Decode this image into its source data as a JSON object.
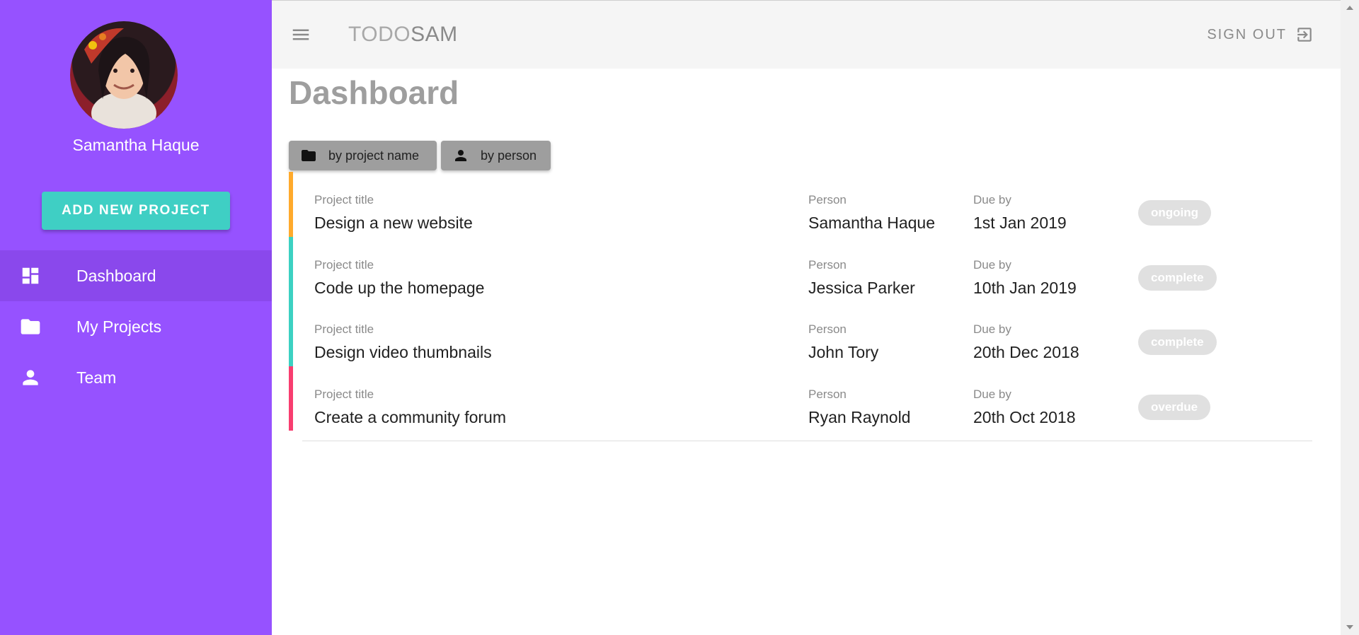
{
  "sidebar": {
    "user_name": "Samantha Haque",
    "add_button_label": "ADD NEW PROJECT",
    "items": [
      {
        "label": "Dashboard",
        "icon": "dashboard-icon",
        "active": true
      },
      {
        "label": "My Projects",
        "icon": "folder-icon",
        "active": false
      },
      {
        "label": "Team",
        "icon": "person-icon",
        "active": false
      }
    ],
    "background_color": "#9652ff",
    "button_color": "#3fcfc4"
  },
  "header": {
    "brand_part1": "TODO",
    "brand_part2": "SAM",
    "signout_label": "SIGN OUT"
  },
  "main": {
    "title": "Dashboard",
    "sort_buttons": [
      {
        "label": "by project name",
        "icon": "folder-icon"
      },
      {
        "label": "by person",
        "icon": "person-icon"
      }
    ],
    "column_labels": {
      "title": "Project title",
      "person": "Person",
      "due": "Due by"
    },
    "projects": [
      {
        "title": "Design a new website",
        "person": "Samantha Haque",
        "due": "1st Jan 2019",
        "status": "ongoing",
        "stripe_color": "#ffaa2c"
      },
      {
        "title": "Code up the homepage",
        "person": "Jessica Parker",
        "due": "10th Jan 2019",
        "status": "complete",
        "stripe_color": "#3cd1c2"
      },
      {
        "title": "Design video thumbnails",
        "person": "John Tory",
        "due": "20th Dec 2018",
        "status": "complete",
        "stripe_color": "#3cd1c2"
      },
      {
        "title": "Create a community forum",
        "person": "Ryan Raynold",
        "due": "20th Oct 2018",
        "status": "overdue",
        "stripe_color": "#f83e70"
      }
    ]
  }
}
